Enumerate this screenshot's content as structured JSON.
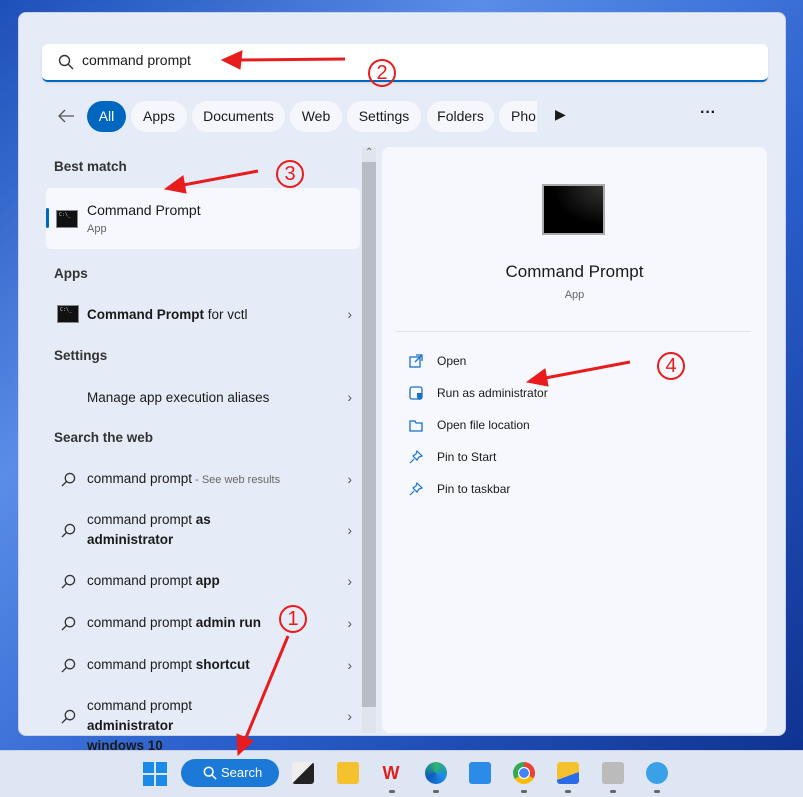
{
  "search": {
    "value": "command prompt",
    "icon": "search-icon"
  },
  "filters": {
    "back_icon": "arrow-left-icon",
    "items": [
      "All",
      "Apps",
      "Documents",
      "Web",
      "Settings",
      "Folders",
      "Pho"
    ],
    "more_icon": "play-icon",
    "overflow_icon": "ellipsis-icon"
  },
  "left": {
    "best_match_header": "Best match",
    "best": {
      "title": "Command Prompt",
      "subtitle": "App"
    },
    "apps_header": "Apps",
    "apps": [
      {
        "bold": "Command Prompt",
        "rest": " for vctl"
      }
    ],
    "settings_header": "Settings",
    "settings": [
      "Manage app execution aliases"
    ],
    "web_header": "Search the web",
    "web": [
      {
        "plain": "command prompt",
        "bold": "",
        "suffix": " - See web results"
      },
      {
        "plain": "command prompt ",
        "bold": "as administrator",
        "suffix": ""
      },
      {
        "plain": "command prompt ",
        "bold": "app",
        "suffix": ""
      },
      {
        "plain": "command prompt ",
        "bold": "admin run",
        "suffix": ""
      },
      {
        "plain": "command prompt ",
        "bold": "shortcut",
        "suffix": ""
      },
      {
        "plain": "command prompt ",
        "bold": "administrator windows 10",
        "suffix": ""
      }
    ]
  },
  "right": {
    "title": "Command Prompt",
    "subtitle": "App",
    "actions": [
      {
        "label": "Open",
        "icon": "open-external-icon"
      },
      {
        "label": "Run as administrator",
        "icon": "shield-window-icon"
      },
      {
        "label": "Open file location",
        "icon": "folder-icon"
      },
      {
        "label": "Pin to Start",
        "icon": "pin-icon"
      },
      {
        "label": "Pin to taskbar",
        "icon": "pin-icon"
      }
    ]
  },
  "taskbar": {
    "search_label": "Search"
  },
  "annotations": {
    "n1": "1",
    "n2": "2",
    "n3": "3",
    "n4": "4",
    "color": "#e81c1c"
  },
  "colors": {
    "accent": "#0067c0"
  }
}
